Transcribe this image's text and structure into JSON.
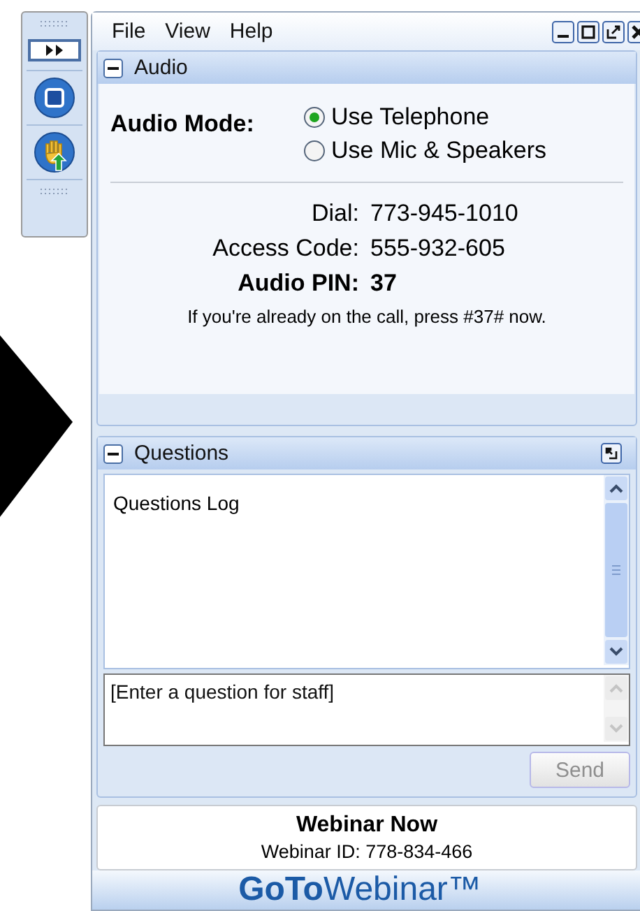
{
  "menu": [
    "File",
    "View",
    "Help"
  ],
  "audio": {
    "title": "Audio",
    "expanded": true,
    "mode_label": "Audio Mode:",
    "options": [
      {
        "label": "Use Telephone",
        "selected": true
      },
      {
        "label": "Use Mic & Speakers",
        "selected": false
      }
    ],
    "details": [
      {
        "label": "Dial:",
        "value": "773-945-1010",
        "emphasis": false
      },
      {
        "label": "Access Code:",
        "value": "555-932-605",
        "emphasis": false
      },
      {
        "label": "Audio PIN:",
        "value": "37",
        "emphasis": true
      }
    ],
    "note": "If you're already on the call, press #37# now."
  },
  "questions": {
    "title": "Questions",
    "expanded": true,
    "log_title": "Questions Log",
    "input": {
      "placeholder": "[Enter a question for staff]"
    },
    "send": {
      "label": "Send",
      "disabled": true
    }
  },
  "webinar": {
    "name": "Webinar Now",
    "id_line": "Webinar ID: 778-834-466"
  },
  "logo": "**GoTo**Webinar™"
}
